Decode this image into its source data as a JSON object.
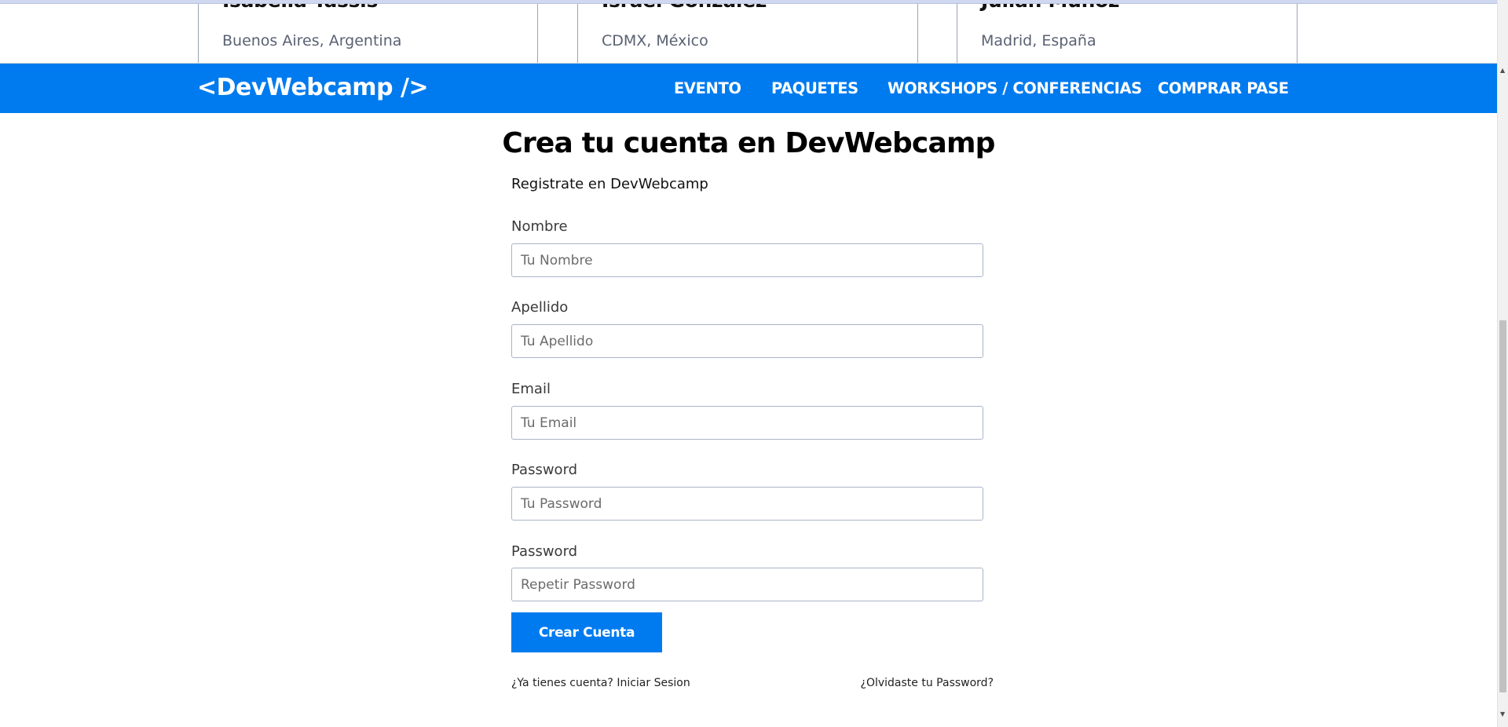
{
  "speakers": [
    {
      "name": "Isabella Tassis",
      "location": "Buenos Aires, Argentina"
    },
    {
      "name": "Israel González",
      "location": "CDMX, México"
    },
    {
      "name": "Julián Muñoz",
      "location": "Madrid, España"
    }
  ],
  "header": {
    "logo": "<DevWebcamp />",
    "nav": [
      "EVENTO",
      "PAQUETES",
      "WORKSHOPS / CONFERENCIAS",
      "COMPRAR PASE"
    ]
  },
  "form": {
    "title": "Crea tu cuenta en DevWebcamp",
    "subtitle": "Registrate en DevWebcamp",
    "fields": [
      {
        "label": "Nombre",
        "placeholder": "Tu Nombre"
      },
      {
        "label": "Apellido",
        "placeholder": "Tu Apellido"
      },
      {
        "label": "Email",
        "placeholder": "Tu Email"
      },
      {
        "label": "Password",
        "placeholder": "Tu Password"
      },
      {
        "label": "Password",
        "placeholder": "Repetir Password"
      }
    ],
    "submit_label": "Crear Cuenta",
    "login_link": "¿Ya tienes cuenta? Iniciar Sesion",
    "forgot_link": "¿Olvidaste tu Password?"
  },
  "colors": {
    "primary": "#007bef"
  },
  "icons": {
    "scroll_up": "chevron-up-icon",
    "scroll_down": "chevron-down-icon"
  }
}
